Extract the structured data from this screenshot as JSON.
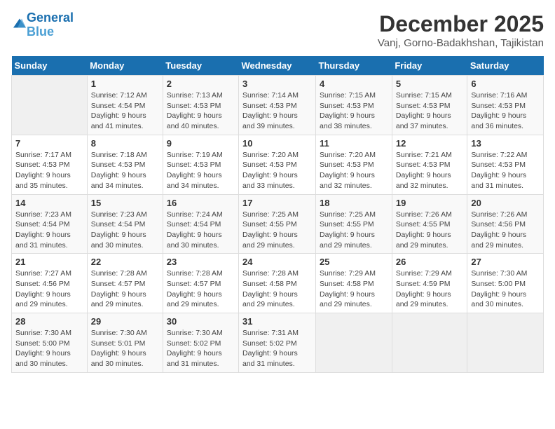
{
  "logo": {
    "line1": "General",
    "line2": "Blue"
  },
  "title": "December 2025",
  "subtitle": "Vanj, Gorno-Badakhshan, Tajikistan",
  "days_of_week": [
    "Sunday",
    "Monday",
    "Tuesday",
    "Wednesday",
    "Thursday",
    "Friday",
    "Saturday"
  ],
  "weeks": [
    [
      {
        "day": "",
        "info": ""
      },
      {
        "day": "1",
        "info": "Sunrise: 7:12 AM\nSunset: 4:54 PM\nDaylight: 9 hours\nand 41 minutes."
      },
      {
        "day": "2",
        "info": "Sunrise: 7:13 AM\nSunset: 4:53 PM\nDaylight: 9 hours\nand 40 minutes."
      },
      {
        "day": "3",
        "info": "Sunrise: 7:14 AM\nSunset: 4:53 PM\nDaylight: 9 hours\nand 39 minutes."
      },
      {
        "day": "4",
        "info": "Sunrise: 7:15 AM\nSunset: 4:53 PM\nDaylight: 9 hours\nand 38 minutes."
      },
      {
        "day": "5",
        "info": "Sunrise: 7:15 AM\nSunset: 4:53 PM\nDaylight: 9 hours\nand 37 minutes."
      },
      {
        "day": "6",
        "info": "Sunrise: 7:16 AM\nSunset: 4:53 PM\nDaylight: 9 hours\nand 36 minutes."
      }
    ],
    [
      {
        "day": "7",
        "info": "Sunrise: 7:17 AM\nSunset: 4:53 PM\nDaylight: 9 hours\nand 35 minutes."
      },
      {
        "day": "8",
        "info": "Sunrise: 7:18 AM\nSunset: 4:53 PM\nDaylight: 9 hours\nand 34 minutes."
      },
      {
        "day": "9",
        "info": "Sunrise: 7:19 AM\nSunset: 4:53 PM\nDaylight: 9 hours\nand 34 minutes."
      },
      {
        "day": "10",
        "info": "Sunrise: 7:20 AM\nSunset: 4:53 PM\nDaylight: 9 hours\nand 33 minutes."
      },
      {
        "day": "11",
        "info": "Sunrise: 7:20 AM\nSunset: 4:53 PM\nDaylight: 9 hours\nand 32 minutes."
      },
      {
        "day": "12",
        "info": "Sunrise: 7:21 AM\nSunset: 4:53 PM\nDaylight: 9 hours\nand 32 minutes."
      },
      {
        "day": "13",
        "info": "Sunrise: 7:22 AM\nSunset: 4:53 PM\nDaylight: 9 hours\nand 31 minutes."
      }
    ],
    [
      {
        "day": "14",
        "info": "Sunrise: 7:23 AM\nSunset: 4:54 PM\nDaylight: 9 hours\nand 31 minutes."
      },
      {
        "day": "15",
        "info": "Sunrise: 7:23 AM\nSunset: 4:54 PM\nDaylight: 9 hours\nand 30 minutes."
      },
      {
        "day": "16",
        "info": "Sunrise: 7:24 AM\nSunset: 4:54 PM\nDaylight: 9 hours\nand 30 minutes."
      },
      {
        "day": "17",
        "info": "Sunrise: 7:25 AM\nSunset: 4:55 PM\nDaylight: 9 hours\nand 29 minutes."
      },
      {
        "day": "18",
        "info": "Sunrise: 7:25 AM\nSunset: 4:55 PM\nDaylight: 9 hours\nand 29 minutes."
      },
      {
        "day": "19",
        "info": "Sunrise: 7:26 AM\nSunset: 4:55 PM\nDaylight: 9 hours\nand 29 minutes."
      },
      {
        "day": "20",
        "info": "Sunrise: 7:26 AM\nSunset: 4:56 PM\nDaylight: 9 hours\nand 29 minutes."
      }
    ],
    [
      {
        "day": "21",
        "info": "Sunrise: 7:27 AM\nSunset: 4:56 PM\nDaylight: 9 hours\nand 29 minutes."
      },
      {
        "day": "22",
        "info": "Sunrise: 7:28 AM\nSunset: 4:57 PM\nDaylight: 9 hours\nand 29 minutes."
      },
      {
        "day": "23",
        "info": "Sunrise: 7:28 AM\nSunset: 4:57 PM\nDaylight: 9 hours\nand 29 minutes."
      },
      {
        "day": "24",
        "info": "Sunrise: 7:28 AM\nSunset: 4:58 PM\nDaylight: 9 hours\nand 29 minutes."
      },
      {
        "day": "25",
        "info": "Sunrise: 7:29 AM\nSunset: 4:58 PM\nDaylight: 9 hours\nand 29 minutes."
      },
      {
        "day": "26",
        "info": "Sunrise: 7:29 AM\nSunset: 4:59 PM\nDaylight: 9 hours\nand 29 minutes."
      },
      {
        "day": "27",
        "info": "Sunrise: 7:30 AM\nSunset: 5:00 PM\nDaylight: 9 hours\nand 30 minutes."
      }
    ],
    [
      {
        "day": "28",
        "info": "Sunrise: 7:30 AM\nSunset: 5:00 PM\nDaylight: 9 hours\nand 30 minutes."
      },
      {
        "day": "29",
        "info": "Sunrise: 7:30 AM\nSunset: 5:01 PM\nDaylight: 9 hours\nand 30 minutes."
      },
      {
        "day": "30",
        "info": "Sunrise: 7:30 AM\nSunset: 5:02 PM\nDaylight: 9 hours\nand 31 minutes."
      },
      {
        "day": "31",
        "info": "Sunrise: 7:31 AM\nSunset: 5:02 PM\nDaylight: 9 hours\nand 31 minutes."
      },
      {
        "day": "",
        "info": ""
      },
      {
        "day": "",
        "info": ""
      },
      {
        "day": "",
        "info": ""
      }
    ]
  ]
}
